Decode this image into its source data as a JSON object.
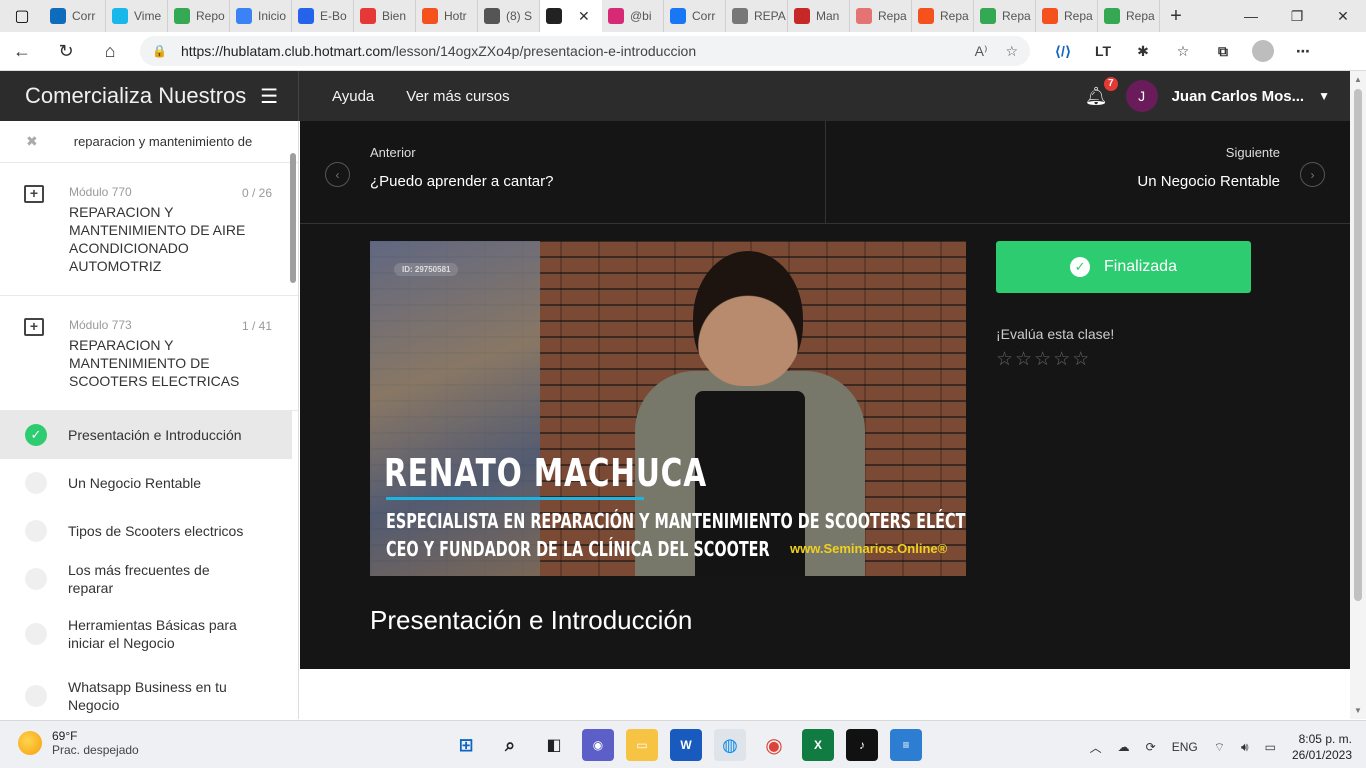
{
  "browser": {
    "tabs": [
      {
        "label": "Corr",
        "color": "#0f6cbd",
        "icon": "outlook-icon"
      },
      {
        "label": "Vime",
        "color": "#1ab7ea",
        "icon": "vimeo-icon"
      },
      {
        "label": "Repo",
        "color": "#34a853",
        "icon": "drive-icon"
      },
      {
        "label": "Inicio",
        "color": "#3b82f6",
        "icon": "site-icon"
      },
      {
        "label": "E-Bo",
        "color": "#2563eb",
        "icon": "ebook-icon"
      },
      {
        "label": "Bien",
        "color": "#e53935",
        "icon": "youtube-icon"
      },
      {
        "label": "Hotr",
        "color": "#f4511e",
        "icon": "hotmart-icon"
      },
      {
        "label": "(8) S",
        "color": "#555555",
        "icon": "m-icon"
      },
      {
        "label": "",
        "color": "#222222",
        "icon": "speaker-icon",
        "active": true
      },
      {
        "label": "@bi",
        "color": "#d62976",
        "icon": "instagram-icon"
      },
      {
        "label": "Corr",
        "color": "#1877f2",
        "icon": "facebook-icon"
      },
      {
        "label": "REPA",
        "color": "#777777",
        "icon": "doc-icon"
      },
      {
        "label": "Man",
        "color": "#c62828",
        "icon": "pdf-icon"
      },
      {
        "label": "Repa",
        "color": "#e57373",
        "icon": "video-icon"
      },
      {
        "label": "Repa",
        "color": "#f4511e",
        "icon": "hotmart-icon"
      },
      {
        "label": "Repa",
        "color": "#34a853",
        "icon": "drive-icon"
      },
      {
        "label": "Repa",
        "color": "#f4511e",
        "icon": "hotmart-icon"
      },
      {
        "label": "Repa",
        "color": "#34a853",
        "icon": "drive-icon"
      }
    ],
    "url_host": "https://hublatam.club.hotmart.com",
    "url_path": "/lesson/14ogxZXo4p/presentacion-e-introduccion"
  },
  "header": {
    "course_title": "Comercializa Nuestros",
    "links": [
      "Ayuda",
      "Ver más cursos"
    ],
    "notification_count": "7",
    "user_initial": "J",
    "user_name": "Juan Carlos Mos..."
  },
  "sidebar": {
    "search_text": "reparacion y mantenimiento de",
    "modules": [
      {
        "num": "Módulo 770",
        "count": "0 / 26",
        "title": "REPARACION Y MANTENIMIENTO DE AIRE ACONDICIONADO AUTOMOTRIZ"
      },
      {
        "num": "Módulo 773",
        "count": "1 / 41",
        "title": "REPARACION Y MANTENIMIENTO DE SCOOTERS ELECTRICAS"
      }
    ],
    "lessons": [
      {
        "title": "Presentación e Introducción",
        "done": true
      },
      {
        "title": "Un Negocio Rentable",
        "done": false
      },
      {
        "title": "Tipos de Scooters electricos",
        "done": false
      },
      {
        "title": "Los más frecuentes de reparar",
        "done": false
      },
      {
        "title": "Herramientas Básicas para iniciar el Negocio",
        "done": false
      },
      {
        "title": "Whatsapp Business en tu Negocio",
        "done": false
      }
    ]
  },
  "lesson_nav": {
    "prev_label": "Anterior",
    "prev_title": "¿Puedo aprender a cantar?",
    "next_label": "Siguiente",
    "next_title": "Un Negocio Rentable"
  },
  "video": {
    "id_tag": "ID: 29750581",
    "name": "RENATO MACHUCA",
    "role": "ESPECIALISTA EN REPARACIÓN Y MANTENIMIENTO DE SCOOTERS ELÉCTRICOS",
    "ceo": "CEO Y FUNDADOR DE LA CLÍNICA DEL SCOOTER",
    "site": "www.Seminarios.Online®"
  },
  "lesson": {
    "done_label": "Finalizada",
    "rate_label": "¡Evalúa esta clase!",
    "rating": 0,
    "heading": "Presentación e Introducción"
  },
  "taskbar": {
    "temp": "69°F",
    "weather": "Prac. despejado",
    "lang": "ENG",
    "time": "8:05 p. m.",
    "date": "26/01/2023"
  }
}
